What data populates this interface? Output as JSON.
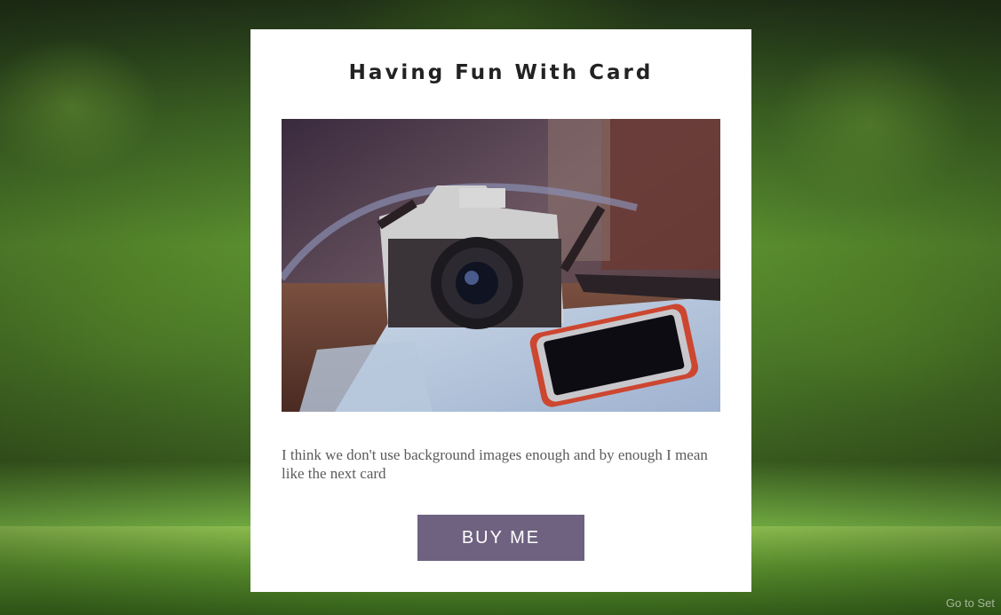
{
  "card": {
    "title": "Having Fun With Card",
    "image_alt": "camera-and-phone-on-map-photo",
    "description": "I think we don't use background images enough and by enough I mean like the next card",
    "button_label": "BUY ME"
  },
  "watermark": {
    "text": "Go to Set"
  },
  "colors": {
    "button_bg": "#6e6280",
    "card_bg": "#ffffff",
    "title_color": "#222222",
    "text_color": "#5b5b5b"
  }
}
